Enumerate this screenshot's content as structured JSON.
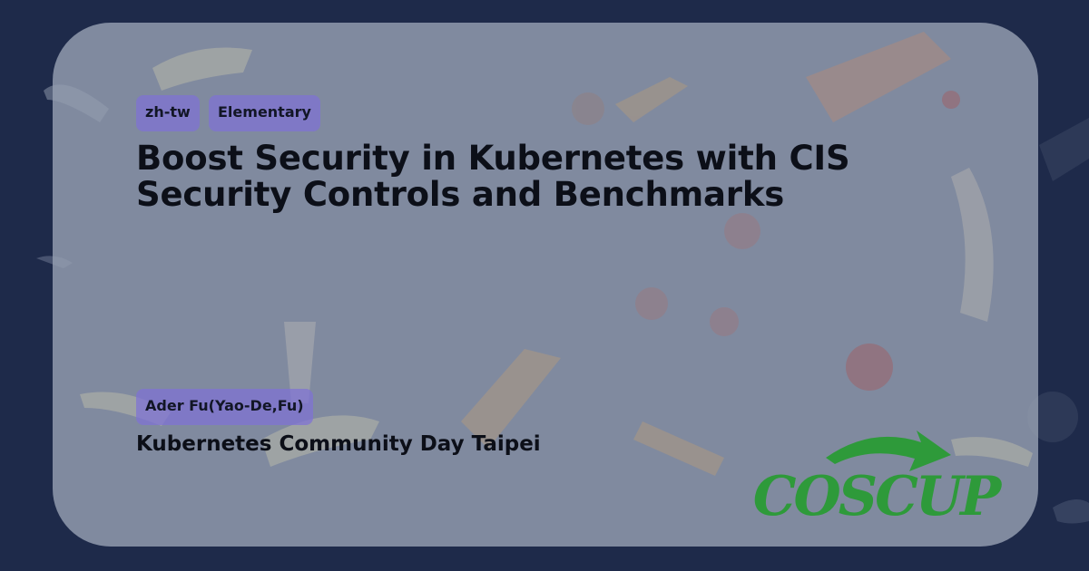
{
  "tags": {
    "language": "zh-tw",
    "level": "Elementary",
    "speaker": "Ader Fu(Yao-De,Fu)"
  },
  "talk": {
    "title": "Boost Security in Kubernetes with CIS Security Controls and Benchmarks",
    "event": "Kubernetes Community Day Taipei"
  },
  "logo": {
    "text": "COSCUP",
    "color": "#2e9a3a"
  },
  "colors": {
    "page_background": "#1e2a4a",
    "card_background": "#96a0b2",
    "tag_background": "#7e72d6",
    "text": "#0c0f18"
  }
}
